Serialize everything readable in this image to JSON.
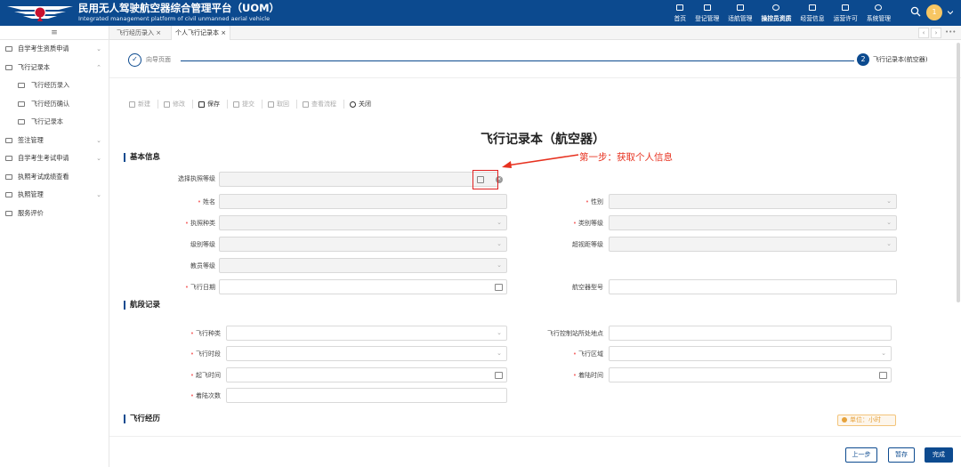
{
  "header": {
    "title": "民用无人驾驶航空器综合管理平台（UOM）",
    "subtitle": "Integrated management platform of civil unmanned aerial vehicle",
    "nav": [
      "首页",
      "登记管理",
      "适航管理",
      "操控员资质",
      "经营信息",
      "运营许可",
      "系统管理"
    ],
    "active_nav": 3,
    "avatar": "1"
  },
  "sidebar": {
    "items": [
      {
        "label": "自学考生资质申请",
        "level": 1,
        "expanded": false
      },
      {
        "label": "飞行记录本",
        "level": 1,
        "expanded": true
      },
      {
        "label": "飞行经历录入",
        "level": 2
      },
      {
        "label": "飞行经历确认",
        "level": 2
      },
      {
        "label": "飞行记录本",
        "level": 2
      },
      {
        "label": "签注管理",
        "level": 1,
        "expanded": false
      },
      {
        "label": "自学考生考试申请",
        "level": 1,
        "expanded": false
      },
      {
        "label": "执照考试成绩查看",
        "level": 1
      },
      {
        "label": "执照管理",
        "level": 1,
        "expanded": false
      },
      {
        "label": "服务评价",
        "level": 1
      }
    ]
  },
  "tabs": [
    {
      "label": "飞行经历录入 ×"
    },
    {
      "label": "个人飞行记录本 ×"
    }
  ],
  "steps": {
    "step1_num": "✓",
    "step1_label": "向导页面",
    "step2_num": "2",
    "step2_label": "飞行记录本(航空器)"
  },
  "toolbar": {
    "new": "新建",
    "edit": "修改",
    "save": "保存",
    "submit": "提交",
    "withdraw": "取回",
    "view_flow": "查看流程",
    "close": "关闭"
  },
  "form": {
    "title": "飞行记录本（航空器）",
    "annotation": "第一步：获取个人信息",
    "sections": {
      "basic": "基本信息",
      "leg": "航段记录",
      "experience": "飞行经历"
    },
    "labels": {
      "select_license_level": "选择执照等级",
      "name": "姓名",
      "gender": "性别",
      "license_type": "执照种类",
      "category_level": "类别等级",
      "class_level": "级别等级",
      "bvlos_level": "超视距等级",
      "instructor_level": "教员等级",
      "flight_date": "飞行日期",
      "aircraft_model": "航空器型号",
      "flight_type": "飞行种类",
      "control_station": "飞行控制站所处地点",
      "flight_period": "飞行时段",
      "flight_area": "飞行区域",
      "takeoff_time": "起飞时间",
      "landing_time": "着陆时间",
      "landing_count": "着陆次数"
    },
    "unit": "单位：小时"
  },
  "footer": {
    "prev": "上一步",
    "save": "暂存",
    "finish": "完成"
  }
}
